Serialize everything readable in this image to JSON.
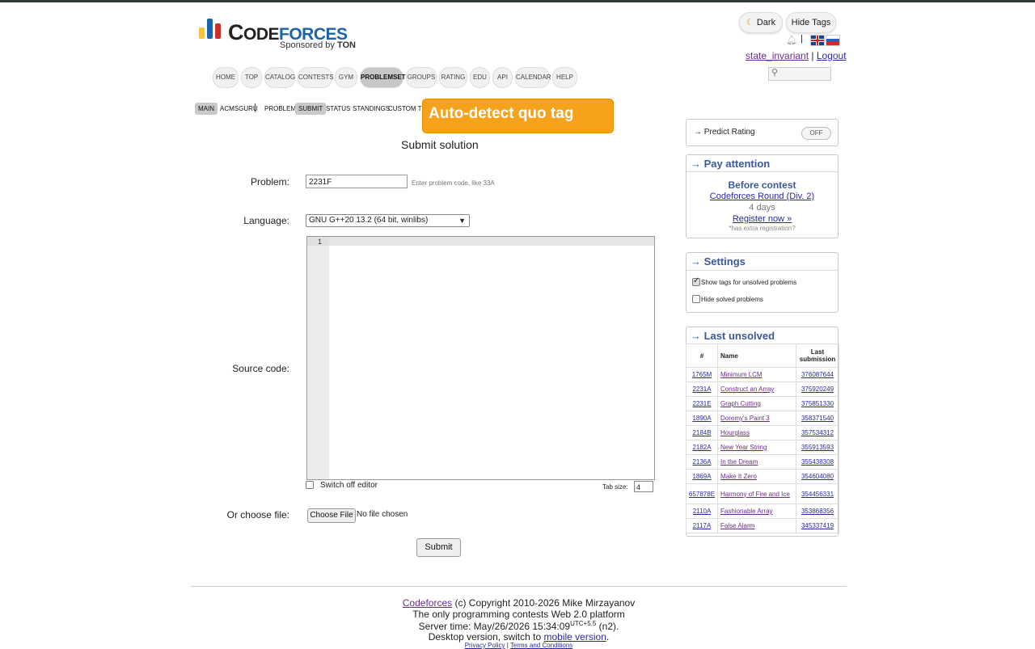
{
  "logo": {
    "part1": "C",
    "part2": "ODE",
    "part3": "FORCES",
    "sponsor_prefix": "Sponsored by",
    "sponsor_name": "TON",
    "bar_colors": [
      "#f6c343",
      "#1c63a8",
      "#c9302c"
    ]
  },
  "top_right": {
    "dark_label": "Dark",
    "dark_icon": "moon-icon",
    "hide_tags_label": "Hide Tags",
    "username": "state_invariant",
    "separator": "|",
    "logout": "Logout"
  },
  "main_menu": [
    "Home",
    "Top",
    "Catalog",
    "Contests",
    "Gym",
    "Problemset",
    "Groups",
    "Rating",
    "Edu",
    "API",
    "Calendar",
    "Help"
  ],
  "main_menu_active": "Problemset",
  "sub_menu": [
    "Main",
    "acmsguru",
    "Problems",
    "Submit",
    "Status",
    "Standings",
    "Custom test"
  ],
  "sub_menu_active": [
    "Main",
    "Submit"
  ],
  "tooltip": "Auto-detect quo tag",
  "form": {
    "title": "Submit solution",
    "problem_label": "Problem:",
    "problem_value": "2231F",
    "problem_hint": "Enter problem code, like 33A",
    "language_label": "Language:",
    "language_value": "GNU G++20 13.2 (64 bit, winlibs)",
    "source_label": "Source code:",
    "line_number": "1",
    "switch_editor_label": "Switch off editor",
    "tab_size_label": "Tab size:",
    "tab_size_value": "4",
    "file_label": "Or choose file:",
    "choose_file": "Choose File",
    "no_file": "No file chosen",
    "submit": "Submit"
  },
  "sidebar": {
    "predict_rating": "→ Predict Rating",
    "predict_toggle": "OFF",
    "pay_attention": {
      "title": "→ Pay attention",
      "before": "Before contest",
      "contest": "Codeforces Round (Div. 2)",
      "days": "4 days",
      "register": "Register now »",
      "extra": "*has extra registration"
    },
    "settings": {
      "title": "→ Settings",
      "show_tags": "Show tags for unsolved problems",
      "hide_solved": "Hide solved problems"
    },
    "last_unsolved": {
      "title": "→ Last unsolved",
      "headers": [
        "#",
        "Name",
        "Last submission"
      ],
      "rows": [
        {
          "id": "1765M",
          "name": "Minimum LCM",
          "sub": "376087644"
        },
        {
          "id": "2231A",
          "name": "Construct an Array",
          "sub": "375920249"
        },
        {
          "id": "2231E",
          "name": "Graph Cutting",
          "sub": "375851330"
        },
        {
          "id": "1890A",
          "name": "Doremy's Paint 3",
          "sub": "358371540"
        },
        {
          "id": "2184B",
          "name": "Hourglass",
          "sub": "357534312"
        },
        {
          "id": "2182A",
          "name": "New Year String",
          "sub": "355913593"
        },
        {
          "id": "2136A",
          "name": "In the Dream",
          "sub": "355438308"
        },
        {
          "id": "1869A",
          "name": "Make It Zero",
          "sub": "354604080"
        },
        {
          "id": "657878E",
          "name": "Harmony of Fire and Ice",
          "sub": "354456331"
        },
        {
          "id": "2110A",
          "name": "Fashionable Array",
          "sub": "353868356"
        },
        {
          "id": "2117A",
          "name": "False Alarm",
          "sub": "345337419"
        }
      ]
    }
  },
  "footer": {
    "site": "Codeforces",
    "copyright": "(c) Copyright 2010-2026 Mike Mirzayanov",
    "tagline": "The only programming contests Web 2.0 platform",
    "server_time_prefix": "Server time: May/26/2026 15:34:09",
    "utc": "UTC+5.5",
    "server_suffix": "(n2).",
    "desktop_prefix": "Desktop version, switch to",
    "mobile": "mobile version",
    "privacy": "Privacy Policy",
    "terms": "Terms and Conditions"
  }
}
